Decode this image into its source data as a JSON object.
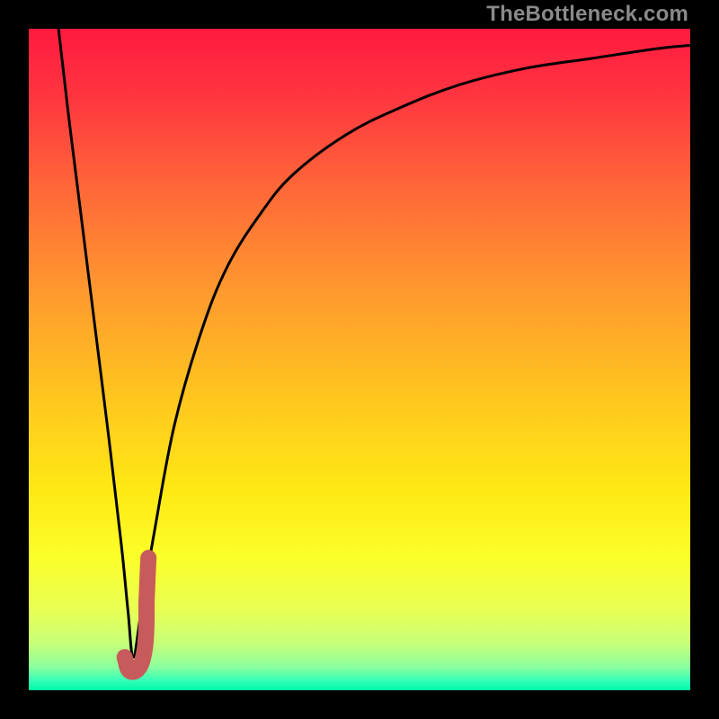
{
  "watermark": "TheBottleneck.com",
  "gradient_stops": [
    {
      "offset": 0.0,
      "color": "#ff1a3f"
    },
    {
      "offset": 0.1,
      "color": "#ff3540"
    },
    {
      "offset": 0.25,
      "color": "#ff6a38"
    },
    {
      "offset": 0.4,
      "color": "#ff9a2e"
    },
    {
      "offset": 0.55,
      "color": "#ffc41f"
    },
    {
      "offset": 0.7,
      "color": "#ffe915"
    },
    {
      "offset": 0.8,
      "color": "#fbff2a"
    },
    {
      "offset": 0.88,
      "color": "#e8ff55"
    },
    {
      "offset": 0.93,
      "color": "#c6ff7a"
    },
    {
      "offset": 0.965,
      "color": "#8bff9d"
    },
    {
      "offset": 0.985,
      "color": "#35ffb8"
    },
    {
      "offset": 1.0,
      "color": "#00f7a8"
    }
  ],
  "chart_data": {
    "type": "line",
    "title": "",
    "xlabel": "",
    "ylabel": "",
    "xlim": [
      0,
      100
    ],
    "ylim": [
      0,
      100
    ],
    "grid": false,
    "series": [
      {
        "name": "bottleneck-curve",
        "x": [
          4.5,
          6,
          8,
          10,
          12,
          14,
          15,
          15.8,
          17,
          19,
          22,
          26,
          30,
          35,
          40,
          48,
          56,
          65,
          75,
          85,
          95,
          100
        ],
        "y": [
          100,
          87,
          71,
          55,
          39,
          22,
          12,
          5,
          12,
          24,
          40,
          54,
          64,
          72,
          78,
          84,
          88,
          91.5,
          94,
          95.5,
          97,
          97.5
        ]
      },
      {
        "name": "marker-j",
        "x": [
          14.5,
          14.8,
          15.0,
          15.5,
          16.3,
          17.0,
          17.5,
          17.7,
          17.8,
          17.8,
          17.9,
          18.0,
          18.1
        ],
        "y": [
          5.0,
          3.8,
          3.2,
          2.8,
          3.0,
          4.0,
          6.0,
          8.0,
          10.5,
          13.0,
          15.5,
          18.0,
          20.0
        ]
      }
    ],
    "colors": {
      "curve": "#000000",
      "marker": "#c75a5a"
    }
  }
}
